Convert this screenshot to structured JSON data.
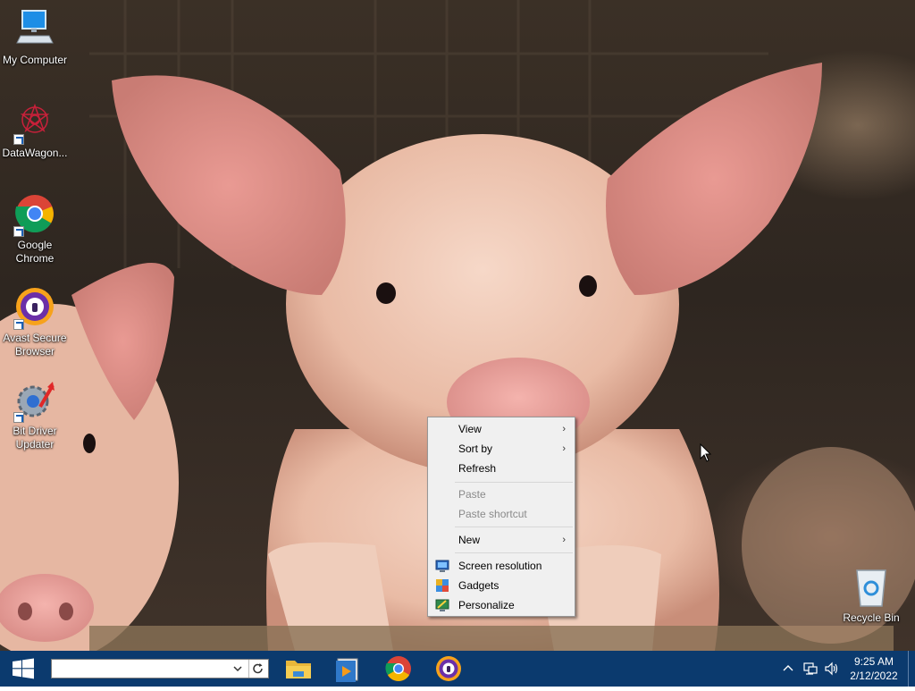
{
  "desktop": {
    "icons": [
      {
        "label": "My Computer",
        "icon": "computer-icon"
      },
      {
        "label": "DataWagon...",
        "icon": "datawagon-icon"
      },
      {
        "label": "Google Chrome",
        "icon": "chrome-icon"
      },
      {
        "label": "Avast Secure Browser",
        "icon": "avast-browser-icon"
      },
      {
        "label": "Bit Driver Updater",
        "icon": "bit-driver-updater-icon"
      },
      {
        "label": "Recycle Bin",
        "icon": "recycle-bin-icon"
      }
    ]
  },
  "context_menu": {
    "items": [
      {
        "label": "View",
        "submenu": true,
        "enabled": true
      },
      {
        "label": "Sort by",
        "submenu": true,
        "enabled": true
      },
      {
        "label": "Refresh",
        "submenu": false,
        "enabled": true
      },
      {
        "label": "Paste",
        "submenu": false,
        "enabled": false
      },
      {
        "label": "Paste shortcut",
        "submenu": false,
        "enabled": false
      },
      {
        "label": "New",
        "submenu": true,
        "enabled": true
      },
      {
        "label": "Screen resolution",
        "icon": "screen-resolution-icon",
        "enabled": true
      },
      {
        "label": "Gadgets",
        "icon": "gadgets-icon",
        "enabled": true
      },
      {
        "label": "Personalize",
        "icon": "personalize-icon",
        "enabled": true
      }
    ],
    "submenu_glyph": "›"
  },
  "taskbar": {
    "search": {
      "value": "",
      "placeholder": ""
    },
    "pinned_apps": [
      "file-explorer-icon",
      "media-player-icon",
      "chrome-icon",
      "avast-browser-icon"
    ],
    "tray": {
      "time": "9:25 AM",
      "date": "2/12/2022"
    },
    "colors": {
      "taskbar": "#0b3a6e",
      "accent": "#1a5fb4"
    }
  }
}
